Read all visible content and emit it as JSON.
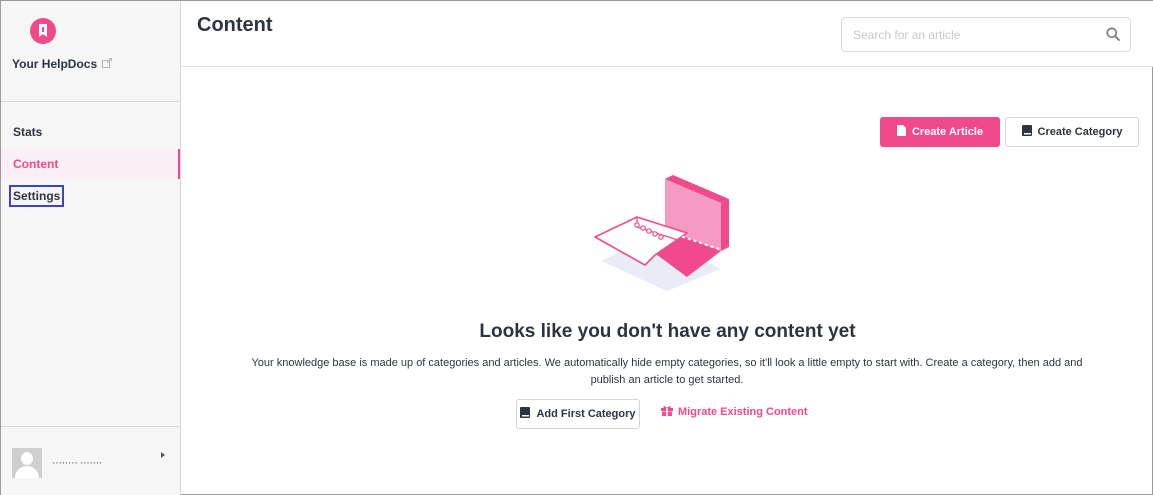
{
  "sidebar": {
    "brand": "Your HelpDocs",
    "nav": [
      {
        "label": "Stats"
      },
      {
        "label": "Content"
      },
      {
        "label": "Settings"
      }
    ],
    "user_name": "········ ·······"
  },
  "header": {
    "title": "Content",
    "search_placeholder": "Search for an article"
  },
  "toolbar": {
    "create_article": "Create Article",
    "create_category": "Create Category"
  },
  "empty_state": {
    "title": "Looks like you don't have any content yet",
    "description": "Your knowledge base is made up of categories and articles. We automatically hide empty categories, so it'll look a little empty to start with. Create a category, then add and publish an article to get started.",
    "add_first_category": "Add First Category",
    "migrate_content": "Migrate Existing Content"
  },
  "colors": {
    "accent": "#f0498c",
    "active_bg": "#fceff5",
    "highlight_box": "#3f44c6"
  },
  "icons": [
    "logo-bookmark-icon",
    "external-link-icon",
    "search-icon",
    "document-icon",
    "book-icon",
    "gift-icon",
    "dropdown-caret-icon"
  ]
}
